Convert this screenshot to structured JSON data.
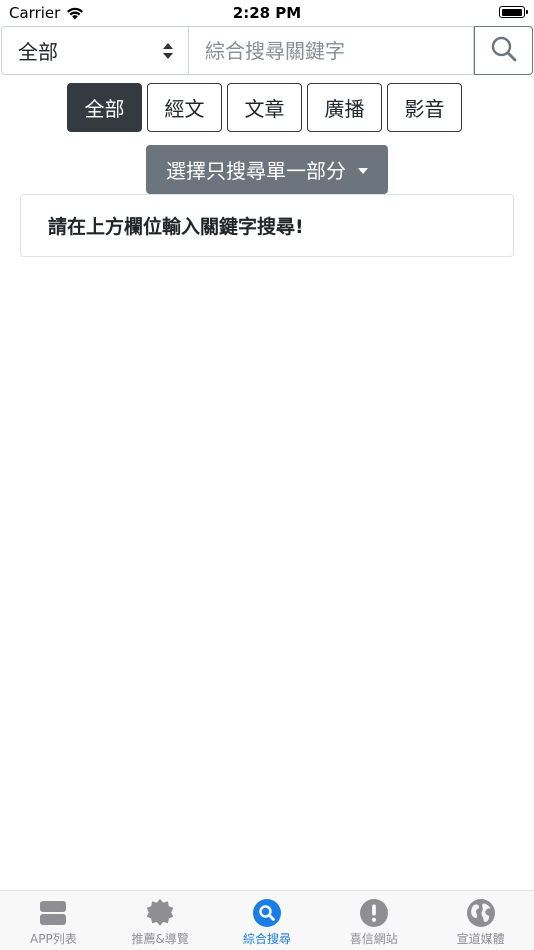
{
  "status_bar": {
    "carrier": "Carrier",
    "time": "2:28 PM",
    "battery_level": 1.0
  },
  "search": {
    "scope_value": "全部",
    "placeholder": "綜合搜尋關鍵字",
    "query": "",
    "button_icon": "search-icon"
  },
  "categories": [
    {
      "label": "全部",
      "active": true
    },
    {
      "label": "經文",
      "active": false
    },
    {
      "label": "文章",
      "active": false
    },
    {
      "label": "廣播",
      "active": false
    },
    {
      "label": "影音",
      "active": false
    }
  ],
  "part_dropdown": {
    "label": "選擇只搜尋單一部分",
    "icon": "caret-down-icon"
  },
  "info": {
    "message": "請在上方欄位輸入關鍵字搜尋!"
  },
  "tab_bar": {
    "items": [
      {
        "label": "APP列表",
        "icon": "app-list-icon",
        "active": false
      },
      {
        "label": "推薦&導覽",
        "icon": "badge-icon",
        "active": false
      },
      {
        "label": "綜合搜尋",
        "icon": "search-icon",
        "active": true
      },
      {
        "label": "喜信網站",
        "icon": "exclamation-icon",
        "active": false
      },
      {
        "label": "宣道媒體",
        "icon": "globe-icon",
        "active": false
      }
    ]
  },
  "colors": {
    "accent": "#1a7ee8",
    "tab_inactive": "#8e8e93",
    "dark_button": "#343a40",
    "secondary_button": "#6c757d"
  }
}
